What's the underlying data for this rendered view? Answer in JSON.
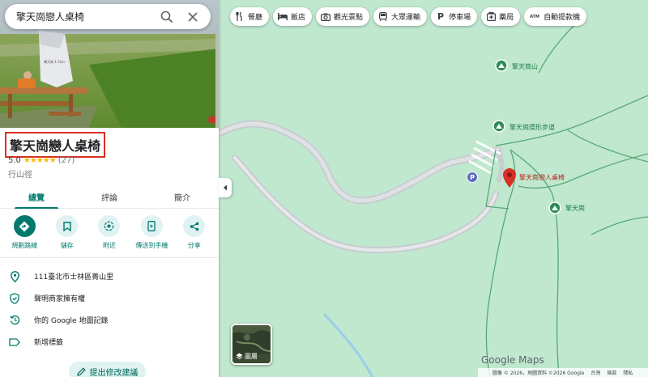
{
  "search": {
    "query": "擎天崗戀人桌椅"
  },
  "place": {
    "name": "擎天崗戀人桌椅",
    "rating": "5.0",
    "stars": "★★★★★",
    "reviews": "(27)",
    "category": "行山徑",
    "sign_text": "擎天崗 1.5km"
  },
  "tabs": [
    {
      "label": "總覽",
      "active": true
    },
    {
      "label": "評論",
      "active": false
    },
    {
      "label": "簡介",
      "active": false
    }
  ],
  "actions": [
    {
      "label": "規劃路線",
      "icon": "directions-icon"
    },
    {
      "label": "儲存",
      "icon": "bookmark-icon"
    },
    {
      "label": "附近",
      "icon": "nearby-icon"
    },
    {
      "label": "傳送到手機",
      "icon": "send-to-phone-icon"
    },
    {
      "label": "分享",
      "icon": "share-icon"
    }
  ],
  "info": [
    {
      "text": "111臺北市士林區菁山里",
      "icon": "location-pin-icon"
    },
    {
      "text": "聲明商家擁有權",
      "icon": "verified-shield-icon"
    },
    {
      "text": "你的 Google 地圖記錄",
      "icon": "history-icon"
    },
    {
      "text": "新增標籤",
      "icon": "label-icon"
    }
  ],
  "suggest_edit": "提出修改建議",
  "chips": [
    {
      "label": "餐廳",
      "icon": "restaurant-icon"
    },
    {
      "label": "飯店",
      "icon": "hotel-icon"
    },
    {
      "label": "觀光景點",
      "icon": "camera-icon"
    },
    {
      "label": "大眾運輸",
      "icon": "transit-icon"
    },
    {
      "label": "停車場",
      "icon": "parking-icon"
    },
    {
      "label": "藥局",
      "icon": "pharmacy-icon"
    },
    {
      "label": "自動提款機",
      "icon": "atm-icon"
    }
  ],
  "map_labels": {
    "mountain": "擎天崗山",
    "trail": "擎天崗環形步道",
    "selected": "擎天崗戀人桌椅",
    "area": "擎天崗"
  },
  "layers_label": "圖層",
  "logo": "Google Maps",
  "footer": [
    "圖像 © 2026，地圖資料 ©2026 Google",
    "台灣",
    "條款",
    "隱私"
  ],
  "colors": {
    "accent": "#00796b",
    "map_bg": "#bfe8cf",
    "pin": "#d93025",
    "highlight_box": "#d93025"
  }
}
